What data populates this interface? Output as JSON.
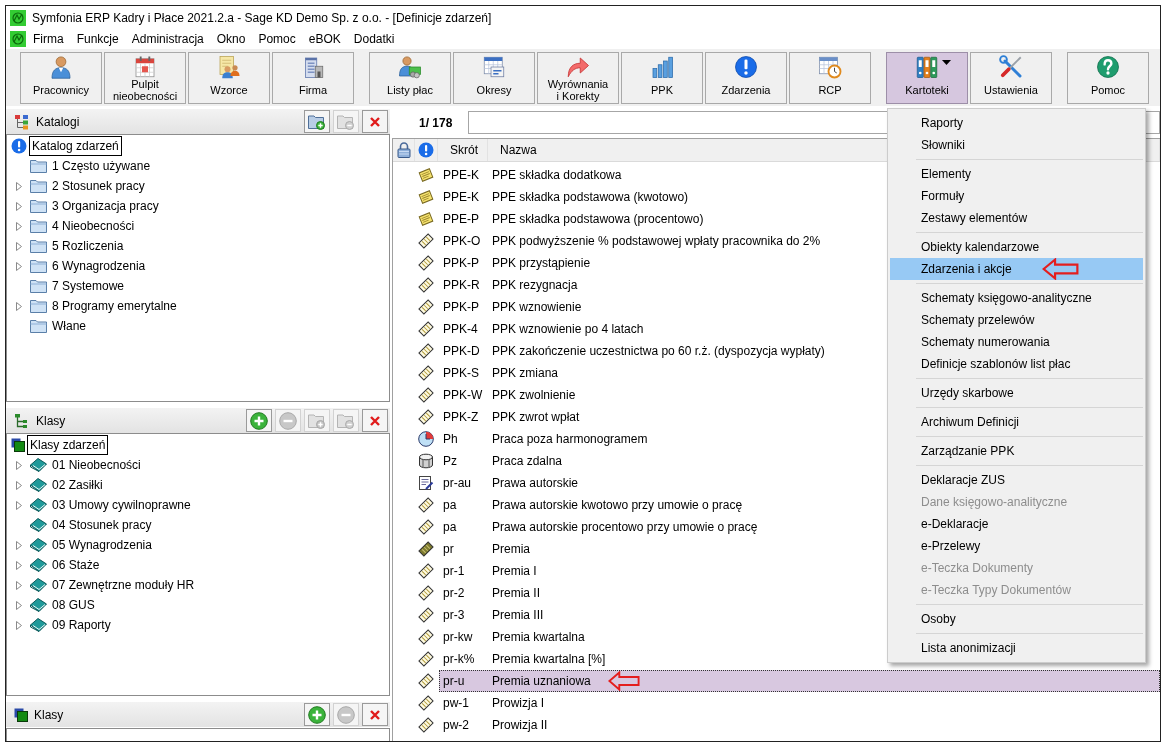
{
  "window": {
    "title": "Symfonia ERP Kadry i Płace 2021.2.a - Sage KD Demo Sp. z o.o. - [Definicje zdarzeń]"
  },
  "menu_bar": [
    "Firma",
    "Funkcje",
    "Administracja",
    "Okno",
    "Pomoc",
    "eBOK",
    "Dodatki"
  ],
  "toolbar": {
    "groups": [
      {
        "buttons": [
          {
            "label": "Pracownicy",
            "selected": false,
            "dropdown": false
          },
          {
            "label": "Pulpit\nnieobecności",
            "selected": false,
            "dropdown": false
          },
          {
            "label": "Wzorce",
            "selected": false,
            "dropdown": false
          },
          {
            "label": "Firma",
            "selected": false,
            "dropdown": false
          }
        ]
      },
      {
        "buttons": [
          {
            "label": "Listy płac",
            "selected": false,
            "dropdown": false
          },
          {
            "label": "Okresy",
            "selected": false,
            "dropdown": false
          },
          {
            "label": "Wyrównania\ni Korekty",
            "selected": false,
            "dropdown": false
          },
          {
            "label": "PPK",
            "selected": false,
            "dropdown": false
          },
          {
            "label": "Zdarzenia",
            "selected": false,
            "dropdown": false
          },
          {
            "label": "RCP",
            "selected": false,
            "dropdown": false
          }
        ]
      },
      {
        "buttons": [
          {
            "label": "Kartoteki",
            "selected": true,
            "dropdown": true
          },
          {
            "label": "Ustawienia",
            "selected": false,
            "dropdown": false
          }
        ]
      },
      {
        "buttons": [
          {
            "label": "Pomoc",
            "selected": false,
            "dropdown": false
          }
        ]
      }
    ]
  },
  "catalogs_panel": {
    "title": "Katalogi",
    "tools": [
      {
        "kind": "add-folder",
        "disabled": false
      },
      {
        "kind": "remove-folder",
        "disabled": true
      },
      {
        "kind": "close",
        "disabled": false
      }
    ],
    "tree": {
      "label": "Katalog zdarzeń",
      "selected": true,
      "children": [
        {
          "label": "1 Często używane",
          "selected": false,
          "has_children": false
        },
        {
          "label": "2 Stosunek pracy",
          "selected": false,
          "has_children": true
        },
        {
          "label": "3 Organizacja pracy",
          "selected": false,
          "has_children": true
        },
        {
          "label": "4 Nieobecności",
          "selected": false,
          "has_children": true
        },
        {
          "label": "5 Rozliczenia",
          "selected": false,
          "has_children": true
        },
        {
          "label": "6 Wynagrodzenia",
          "selected": false,
          "has_children": true
        },
        {
          "label": "7 Systemowe",
          "selected": false,
          "has_children": false
        },
        {
          "label": "8 Programy emerytalne",
          "selected": false,
          "has_children": true
        },
        {
          "label": "Włane",
          "selected": false,
          "has_children": false
        }
      ]
    }
  },
  "classes_panel": {
    "title": "Klasy",
    "tools": [
      {
        "kind": "add",
        "disabled": false
      },
      {
        "kind": "remove",
        "disabled": true
      },
      {
        "kind": "add-folder",
        "disabled": true
      },
      {
        "kind": "remove-folder",
        "disabled": true
      },
      {
        "kind": "close",
        "disabled": false
      }
    ],
    "tree": {
      "label": "Klasy zdarzeń",
      "selected": true,
      "children": [
        {
          "label": "01 Nieobecności",
          "selected": false,
          "has_children": true
        },
        {
          "label": "02 Zasiłki",
          "selected": false,
          "has_children": true
        },
        {
          "label": "03 Umowy cywilnoprawne",
          "selected": false,
          "has_children": true
        },
        {
          "label": "04 Stosunek pracy",
          "selected": false,
          "has_children": false
        },
        {
          "label": "05 Wynagrodzenia",
          "selected": false,
          "has_children": true
        },
        {
          "label": "06 Staże",
          "selected": false,
          "has_children": true
        },
        {
          "label": "07 Zewnętrzne moduły HR",
          "selected": false,
          "has_children": true
        },
        {
          "label": "08 GUS",
          "selected": false,
          "has_children": true
        },
        {
          "label": "09 Raporty",
          "selected": false,
          "has_children": true
        }
      ]
    }
  },
  "classes_list_panel": {
    "title": "Klasy",
    "tools": [
      {
        "kind": "add",
        "disabled": false
      },
      {
        "kind": "remove",
        "disabled": true
      },
      {
        "kind": "close",
        "disabled": false
      }
    ]
  },
  "events_list": {
    "counter": "1/ 178",
    "columns": [
      "Skrót",
      "Nazwa"
    ],
    "rows": [
      {
        "kind": "notepad",
        "code": "PPE-K",
        "name": "PPE składka dodatkowa",
        "selected": false,
        "arrow": false
      },
      {
        "kind": "notepad",
        "code": "PPE-K",
        "name": "PPE składka podstawowa (kwotowo)",
        "selected": false,
        "arrow": false
      },
      {
        "kind": "notepad",
        "code": "PPE-P",
        "name": "PPE składka podstawowa (procentowo)",
        "selected": false,
        "arrow": false
      },
      {
        "kind": "tag",
        "code": "PPK-O",
        "name": "PPK podwyższenie % podstawowej wpłaty pracownika do 2%",
        "selected": false,
        "arrow": false
      },
      {
        "kind": "tag",
        "code": "PPK-P",
        "name": "PPK przystąpienie",
        "selected": false,
        "arrow": false
      },
      {
        "kind": "tag",
        "code": "PPK-R",
        "name": "PPK rezygnacja",
        "selected": false,
        "arrow": false
      },
      {
        "kind": "tag",
        "code": "PPK-P",
        "name": "PPK wznowienie",
        "selected": false,
        "arrow": false
      },
      {
        "kind": "tag",
        "code": "PPK-4",
        "name": "PPK wznowienie po 4 latach",
        "selected": false,
        "arrow": false
      },
      {
        "kind": "tag",
        "code": "PPK-D",
        "name": "PPK zakończenie uczestnictwa po 60 r.ż. (dyspozycja wypłaty)",
        "selected": false,
        "arrow": false
      },
      {
        "kind": "tag",
        "code": "PPK-S",
        "name": "PPK zmiana",
        "selected": false,
        "arrow": false
      },
      {
        "kind": "tag",
        "code": "PPK-W",
        "name": "PPK zwolnienie",
        "selected": false,
        "arrow": false
      },
      {
        "kind": "tag",
        "code": "PPK-Z",
        "name": "PPK zwrot wpłat",
        "selected": false,
        "arrow": false
      },
      {
        "kind": "dial",
        "code": "Ph",
        "name": "Praca poza harmonogramem",
        "selected": false,
        "arrow": false
      },
      {
        "kind": "drum",
        "code": "Pz",
        "name": "Praca zdalna",
        "selected": false,
        "arrow": false
      },
      {
        "kind": "document",
        "code": "pr-au",
        "name": "Prawa autorskie",
        "selected": false,
        "arrow": false
      },
      {
        "kind": "tag",
        "code": "pa",
        "name": "Prawa autorskie kwotowo przy umowie o pracę",
        "selected": false,
        "arrow": false
      },
      {
        "kind": "tag",
        "code": "pa",
        "name": "Prawa autorskie procentowo przy umowie o pracę",
        "selected": false,
        "arrow": false
      },
      {
        "kind": "dark-tag",
        "code": "pr",
        "name": "Premia",
        "selected": false,
        "arrow": false
      },
      {
        "kind": "tag",
        "code": "pr-1",
        "name": "Premia I",
        "selected": false,
        "arrow": false
      },
      {
        "kind": "tag",
        "code": "pr-2",
        "name": "Premia II",
        "selected": false,
        "arrow": false
      },
      {
        "kind": "tag",
        "code": "pr-3",
        "name": "Premia III",
        "selected": false,
        "arrow": false
      },
      {
        "kind": "tag",
        "code": "pr-kw",
        "name": "Premia kwartalna",
        "selected": false,
        "arrow": false
      },
      {
        "kind": "tag",
        "code": "pr-k%",
        "name": "Premia kwartalna [%]",
        "selected": false,
        "arrow": false
      },
      {
        "kind": "tag",
        "code": "pr-u",
        "name": "Premia uznaniowa",
        "selected": true,
        "arrow": true
      },
      {
        "kind": "tag",
        "code": "pw-1",
        "name": "Prowizja I",
        "selected": false,
        "arrow": false
      },
      {
        "kind": "tag",
        "code": "pw-2",
        "name": "Prowizja II",
        "selected": false,
        "arrow": false
      }
    ]
  },
  "kartoteki_menu": {
    "sections": [
      {
        "items": [
          {
            "label": "Raporty",
            "highlighted": false,
            "disabled": false,
            "arrow": false
          },
          {
            "label": "Słowniki",
            "highlighted": false,
            "disabled": false,
            "arrow": false
          }
        ]
      },
      {
        "items": [
          {
            "label": "Elementy",
            "highlighted": false,
            "disabled": false,
            "arrow": false
          },
          {
            "label": "Formuły",
            "highlighted": false,
            "disabled": false,
            "arrow": false
          },
          {
            "label": "Zestawy elementów",
            "highlighted": false,
            "disabled": false,
            "arrow": false
          }
        ]
      },
      {
        "items": [
          {
            "label": "Obiekty kalendarzowe",
            "highlighted": false,
            "disabled": false,
            "arrow": false
          },
          {
            "label": "Zdarzenia i akcje",
            "highlighted": true,
            "disabled": false,
            "arrow": true
          }
        ]
      },
      {
        "items": [
          {
            "label": "Schematy księgowo-analityczne",
            "highlighted": false,
            "disabled": false,
            "arrow": false
          },
          {
            "label": "Schematy przelewów",
            "highlighted": false,
            "disabled": false,
            "arrow": false
          },
          {
            "label": "Schematy numerowania",
            "highlighted": false,
            "disabled": false,
            "arrow": false
          },
          {
            "label": "Definicje szablonów list płac",
            "highlighted": false,
            "disabled": false,
            "arrow": false
          }
        ]
      },
      {
        "items": [
          {
            "label": "Urzędy skarbowe",
            "highlighted": false,
            "disabled": false,
            "arrow": false
          }
        ]
      },
      {
        "items": [
          {
            "label": "Archiwum Definicji",
            "highlighted": false,
            "disabled": false,
            "arrow": false
          }
        ]
      },
      {
        "items": [
          {
            "label": "Zarządzanie PPK",
            "highlighted": false,
            "disabled": false,
            "arrow": false
          }
        ]
      },
      {
        "items": [
          {
            "label": "Deklaracje ZUS",
            "highlighted": false,
            "disabled": false,
            "arrow": false
          },
          {
            "label": "Dane księgowo-analityczne",
            "highlighted": false,
            "disabled": true,
            "arrow": false
          },
          {
            "label": "e-Deklaracje",
            "highlighted": false,
            "disabled": false,
            "arrow": false
          },
          {
            "label": "e-Przelewy",
            "highlighted": false,
            "disabled": false,
            "arrow": false
          },
          {
            "label": "e-Teczka Dokumenty",
            "highlighted": false,
            "disabled": true,
            "arrow": false
          },
          {
            "label": "e-Teczka Typy Dokumentów",
            "highlighted": false,
            "disabled": true,
            "arrow": false
          }
        ]
      },
      {
        "items": [
          {
            "label": "Osoby",
            "highlighted": false,
            "disabled": false,
            "arrow": false
          }
        ]
      },
      {
        "items": [
          {
            "label": "Lista anonimizacji",
            "highlighted": false,
            "disabled": false,
            "arrow": false
          }
        ]
      }
    ]
  }
}
